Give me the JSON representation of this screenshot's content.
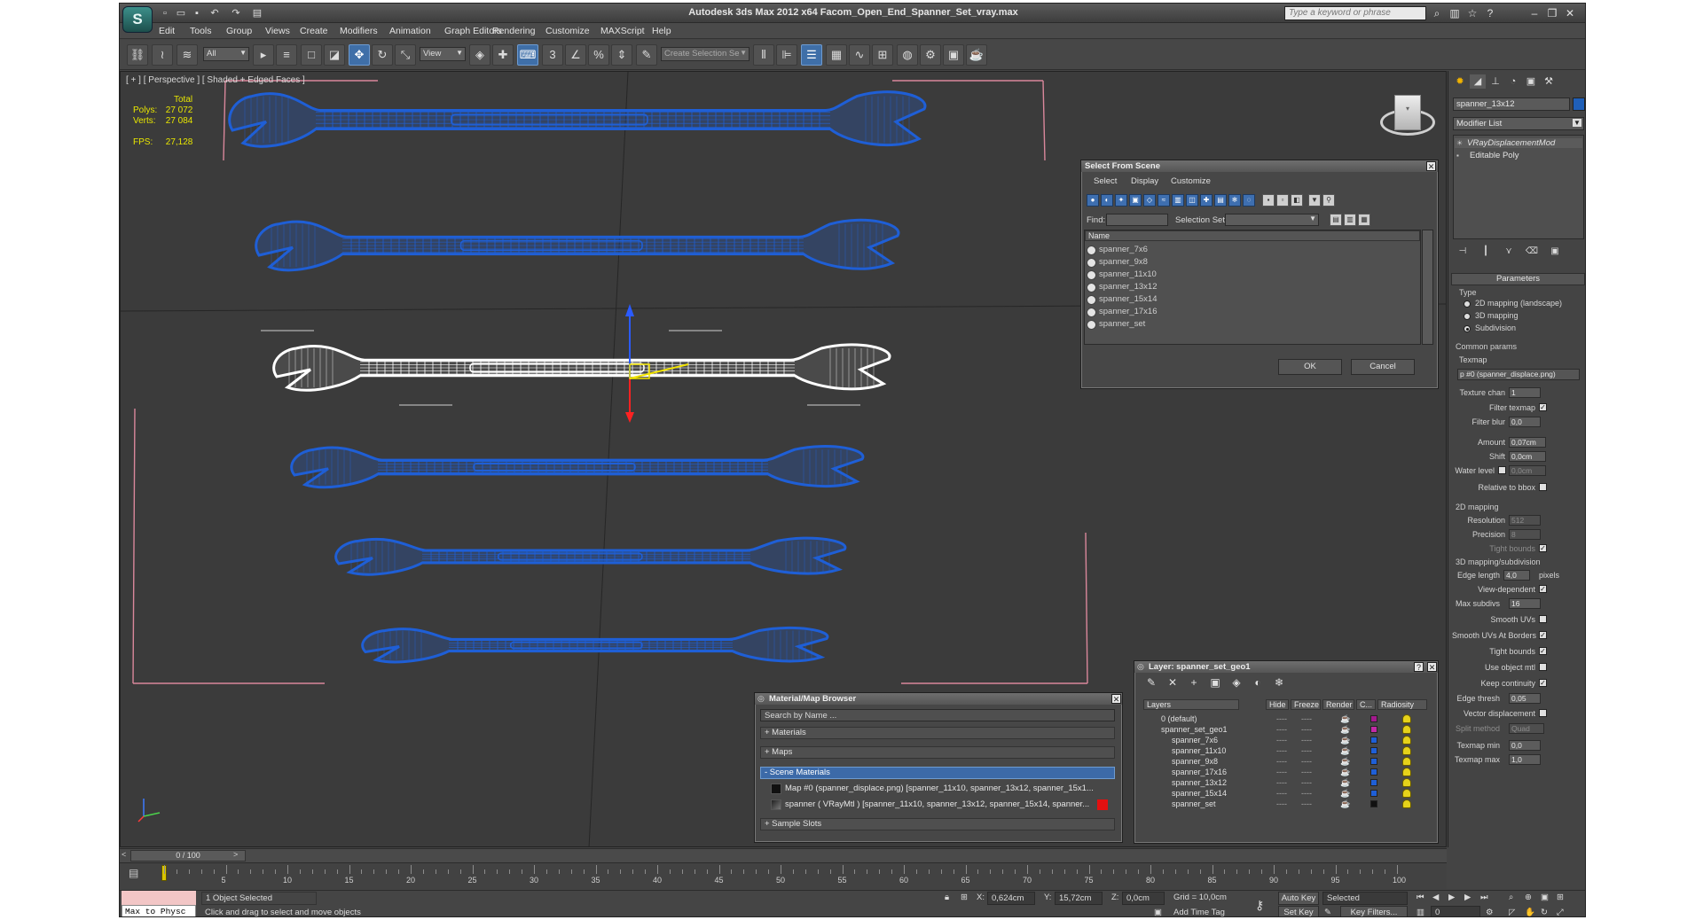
{
  "app": {
    "title": "Autodesk 3ds Max  2012 x64      Facom_Open_End_Spanner_Set_vray.max",
    "search_placeholder": "Type a keyword or phrase",
    "logo": "3ds-max-logo-icon"
  },
  "menu": [
    "Edit",
    "Tools",
    "Group",
    "Views",
    "Create",
    "Modifiers",
    "Animation",
    "Graph Editors",
    "Rendering",
    "Customize",
    "MAXScript",
    "Help"
  ],
  "toolbar": {
    "filter_value": "All",
    "refcoord_value": "View",
    "selection_set_placeholder": "Create Selection Se"
  },
  "viewport": {
    "label": "[ + ] [ Perspective ] [ Shaded + Edged Faces ]",
    "stats": {
      "total_label": "Total",
      "polys_label": "Polys:",
      "polys_value": "27 072",
      "verts_label": "Verts:",
      "verts_value": "27 084",
      "fps_label": "FPS:",
      "fps_value": "27,128"
    },
    "colors": {
      "background": "#3b3b3b",
      "wire_blue": "#1f5fd6",
      "wire_white": "#ffffff",
      "selection_pink": "#d9879b"
    }
  },
  "select_from_scene": {
    "title": "Select From Scene",
    "menu": [
      "Select",
      "Display",
      "Customize"
    ],
    "find_label": "Find:",
    "selection_set_label": "Selection Set:",
    "column_name": "Name",
    "items": [
      "spanner_7x6",
      "spanner_9x8",
      "spanner_11x10",
      "spanner_13x12",
      "spanner_15x14",
      "spanner_17x16",
      "spanner_set"
    ],
    "ok_label": "OK",
    "cancel_label": "Cancel"
  },
  "material_browser": {
    "title": "Material/Map Browser",
    "search_placeholder": "Search by Name ...",
    "sections": [
      "+ Materials",
      "+ Maps",
      "- Scene Materials",
      "+ Sample Slots"
    ],
    "scene_items": [
      "Map #0 (spanner_displace.png)  [spanner_11x10, spanner_13x12, spanner_15x1...",
      "spanner  ( VRayMtl )  [spanner_11x10, spanner_13x12, spanner_15x14, spanner..."
    ]
  },
  "layer_dialog": {
    "title": "Layer: spanner_set_geo1",
    "help_label": "?",
    "columns": [
      "Layers",
      "Hide",
      "Freeze",
      "Render",
      "C...",
      "Radiosity"
    ],
    "rows": [
      {
        "name": "0 (default)",
        "color": "#a21a8c"
      },
      {
        "name": "spanner_set_geo1",
        "color": "#c22aa6"
      },
      {
        "name": "spanner_7x6",
        "color": "#1f5fd6"
      },
      {
        "name": "spanner_11x10",
        "color": "#1f5fd6"
      },
      {
        "name": "spanner_9x8",
        "color": "#1f5fd6"
      },
      {
        "name": "spanner_17x16",
        "color": "#1f5fd6"
      },
      {
        "name": "spanner_13x12",
        "color": "#1f5fd6"
      },
      {
        "name": "spanner_15x14",
        "color": "#1f5fd6"
      },
      {
        "name": "spanner_set",
        "color": "#111111"
      }
    ],
    "dash": "----"
  },
  "command_panel": {
    "object_name": "spanner_13x12",
    "object_color": "#1f5fb8",
    "modifier_list": "Modifier List",
    "stack": [
      "VRayDisplacementMod",
      "Editable Poly"
    ],
    "rollout_parameters": "Parameters",
    "type_label": "Type",
    "type_options": [
      "2D mapping (landscape)",
      "3D mapping",
      "Subdivision"
    ],
    "type_selected": 2,
    "common_params": "Common params",
    "texmap_label": "Texmap",
    "texmap_value": "p #0 (spanner_displace.png)",
    "texture_chan_label": "Texture chan",
    "texture_chan_value": "1",
    "filter_texmap_label": "Filter texmap",
    "filter_blur_label": "Filter blur",
    "filter_blur_value": "0,0",
    "amount_label": "Amount",
    "amount_value": "0,07cm",
    "shift_label": "Shift",
    "shift_value": "0,0cm",
    "water_level_label": "Water level",
    "water_level_value": "0,0cm",
    "relative_bbox_label": "Relative to bbox",
    "mapping2d_group": "2D mapping",
    "resolution_label": "Resolution",
    "resolution_value": "512",
    "precision_label": "Precision",
    "precision_value": "8",
    "tight_bounds_label": "Tight bounds",
    "mapping3d_group": "3D mapping/subdivision",
    "edge_length_label": "Edge length",
    "edge_length_value": "4,0",
    "pixels_label": "pixels",
    "view_dependent_label": "View-dependent",
    "max_subdivs_label": "Max subdivs",
    "max_subdivs_value": "16",
    "smooth_uvs_label": "Smooth UVs",
    "smooth_uvs_borders_label": "Smooth UVs At Borders",
    "tight_bounds2_label": "Tight bounds",
    "use_object_mtl_label": "Use object mtl",
    "keep_continuity_label": "Keep continuity",
    "edge_thresh_label": "Edge thresh",
    "edge_thresh_value": "0,05",
    "vector_displacement_label": "Vector displacement",
    "split_method_label": "Split method",
    "split_method_value": "Quad",
    "texmap_min_label": "Texmap min",
    "texmap_min_value": "0,0",
    "texmap_max_label": "Texmap max",
    "texmap_max_value": "1,0"
  },
  "timeline": {
    "frame_label": "0 / 100",
    "ticks": [
      0,
      5,
      10,
      15,
      20,
      25,
      30,
      35,
      40,
      45,
      50,
      55,
      60,
      65,
      70,
      75,
      80,
      85,
      90,
      95,
      100
    ]
  },
  "status": {
    "maxscript": "Max to Physc",
    "selected": "1 Object Selected",
    "prompt": "Click and drag to select and move objects",
    "x_label": "X:",
    "x_value": "0,624cm",
    "y_label": "Y:",
    "y_value": "15,72cm",
    "z_label": "Z:",
    "z_value": "0,0cm",
    "grid": "Grid = 10,0cm",
    "add_time_tag": "Add Time Tag",
    "auto_key": "Auto Key",
    "set_key": "Set Key",
    "selected_mode": "Selected",
    "key_filters": "Key Filters...",
    "frame_value": "0"
  }
}
